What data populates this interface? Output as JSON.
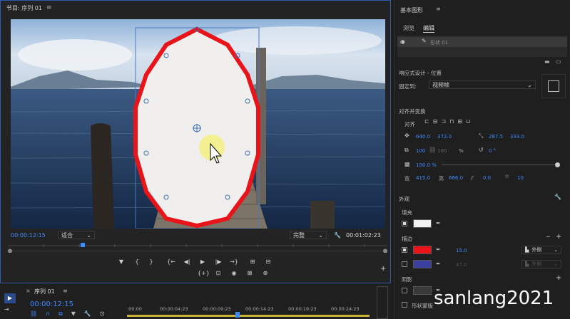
{
  "monitor": {
    "title": "节目: 序列 01",
    "menu_icon": "≡",
    "timecode_current": "00:00:12:15",
    "fit_label": "适合",
    "quality_label": "完整",
    "timecode_total": "00:01:02:23",
    "wrench_icon": "wrench-icon"
  },
  "transport": {
    "buttons": [
      "marker",
      "in",
      "out",
      "go-in",
      "step-back",
      "play",
      "step-forward",
      "go-out",
      "insert",
      "overwrite"
    ],
    "labels": [
      "▼",
      "{",
      "}",
      "{←",
      "◀|",
      "▶",
      "|▶",
      "→}",
      "⊞",
      "⊟"
    ],
    "row2": [
      "{+}",
      "⊡",
      "◉",
      "⊠",
      "⊗"
    ]
  },
  "timeline": {
    "tab": "序列 01",
    "timecode": "00:00:12:15",
    "ticks": [
      ":00:00",
      "00:00:04:23",
      "00:00:09:23",
      "00:00:14:23",
      "00:00:19:23",
      "00:00:24:23"
    ]
  },
  "essential_graphics": {
    "title": "基本图形",
    "tab_browse": "浏览",
    "tab_edit": "编辑",
    "layer_name": "形状 01",
    "responsive_title": "响应式设计 - 位置",
    "pin_label": "固定到:",
    "pin_value": "视频帧",
    "align_title": "对齐并变换",
    "align_label": "对齐",
    "pos_x": "640.0",
    "pos_y": "372.0",
    "anchor_x": "287.5",
    "anchor_y": "333.0",
    "scale": "100",
    "scale2": "100",
    "scale_unit": "%",
    "rotation": "0 °",
    "opacity": "100.0 %",
    "width_label": "宽",
    "width": "415.0",
    "height_label": "高",
    "height": "666.0",
    "corner": "0.0",
    "star": "10",
    "appearance_title": "外观",
    "fill_label": "填充",
    "stroke_label": "描边",
    "stroke_width": "15.0",
    "stroke_type": "外侧",
    "stroke2_width": "47.0",
    "stroke2_type": "外侧",
    "shadow_label": "阴影",
    "mask_label": "形状蒙版"
  },
  "colors": {
    "accent": "#3d8bff",
    "fill_color": "#f2f2f2",
    "stroke_color": "#e8141a",
    "stroke2_color": "#3a3fa0",
    "shadow_color": "#3a3a3a"
  },
  "watermark": "sanlang2021"
}
